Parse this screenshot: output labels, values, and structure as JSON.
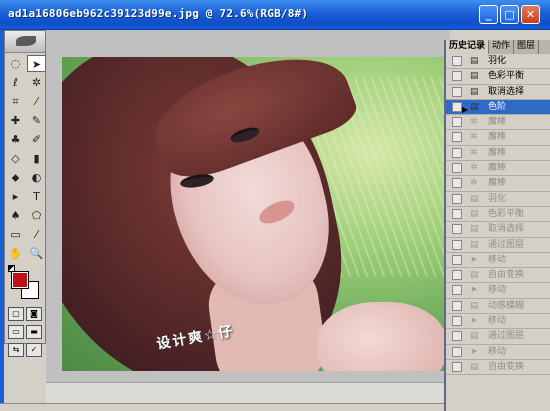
{
  "window": {
    "title": "ad1a16806eb962c39123d99e.jpg @ 72.6%(RGB/8#)",
    "min_label": "_",
    "max_label": "□",
    "close_label": "✕"
  },
  "photo": {
    "watermark": "设计爽☆仔"
  },
  "toolbox": {
    "tools": [
      {
        "name": "marquee-tool-icon",
        "glyph": "◌"
      },
      {
        "name": "move-tool-icon",
        "glyph": "➤",
        "selected": true
      },
      {
        "name": "lasso-tool-icon",
        "glyph": "ℓ"
      },
      {
        "name": "magic-wand-tool-icon",
        "glyph": "✲"
      },
      {
        "name": "crop-tool-icon",
        "glyph": "⌗"
      },
      {
        "name": "slice-tool-icon",
        "glyph": "⁄"
      },
      {
        "name": "healing-brush-tool-icon",
        "glyph": "✚"
      },
      {
        "name": "brush-tool-icon",
        "glyph": "✎"
      },
      {
        "name": "stamp-tool-icon",
        "glyph": "♣"
      },
      {
        "name": "history-brush-tool-icon",
        "glyph": "✐"
      },
      {
        "name": "eraser-tool-icon",
        "glyph": "◇"
      },
      {
        "name": "gradient-tool-icon",
        "glyph": "▮"
      },
      {
        "name": "blur-tool-icon",
        "glyph": "⬥"
      },
      {
        "name": "dodge-tool-icon",
        "glyph": "◐"
      },
      {
        "name": "path-select-tool-icon",
        "glyph": "▸"
      },
      {
        "name": "type-tool-icon",
        "glyph": "T"
      },
      {
        "name": "pen-tool-icon",
        "glyph": "♠"
      },
      {
        "name": "shape-tool-icon",
        "glyph": "⬠"
      },
      {
        "name": "notes-tool-icon",
        "glyph": "▭"
      },
      {
        "name": "eyedropper-tool-icon",
        "glyph": "⁄"
      },
      {
        "name": "hand-tool-icon",
        "glyph": "✋"
      },
      {
        "name": "zoom-tool-icon",
        "glyph": "🔍"
      }
    ],
    "colors": {
      "foreground": "#c01010",
      "background": "#ffffff"
    }
  },
  "history": {
    "tabs": [
      "历史记录",
      "动作",
      "图层"
    ],
    "items": [
      {
        "label": "羽化",
        "icon": "▤",
        "state": "normal"
      },
      {
        "label": "色彩平衡",
        "icon": "▤",
        "state": "normal"
      },
      {
        "label": "取消选择",
        "icon": "▤",
        "state": "normal"
      },
      {
        "label": "色阶",
        "icon": "▤",
        "state": "selected"
      },
      {
        "label": "魔棒",
        "icon": "✲",
        "state": "dim"
      },
      {
        "label": "魔棒",
        "icon": "✲",
        "state": "dim"
      },
      {
        "label": "魔棒",
        "icon": "✲",
        "state": "dim"
      },
      {
        "label": "魔棒",
        "icon": "✲",
        "state": "dim"
      },
      {
        "label": "魔棒",
        "icon": "✲",
        "state": "dim"
      },
      {
        "label": "羽化",
        "icon": "▤",
        "state": "dim"
      },
      {
        "label": "色彩平衡",
        "icon": "▤",
        "state": "dim"
      },
      {
        "label": "取消选择",
        "icon": "▤",
        "state": "dim"
      },
      {
        "label": "通过图层",
        "icon": "▤",
        "state": "dim"
      },
      {
        "label": "移动",
        "icon": "➤",
        "state": "dim"
      },
      {
        "label": "自由变换",
        "icon": "▤",
        "state": "dim"
      },
      {
        "label": "移动",
        "icon": "➤",
        "state": "dim"
      },
      {
        "label": "动感模糊",
        "icon": "▤",
        "state": "dim"
      },
      {
        "label": "移动",
        "icon": "➤",
        "state": "dim"
      },
      {
        "label": "通过图层",
        "icon": "▤",
        "state": "dim"
      },
      {
        "label": "移动",
        "icon": "➤",
        "state": "dim"
      },
      {
        "label": "自由变换",
        "icon": "▤",
        "state": "dim"
      }
    ]
  }
}
